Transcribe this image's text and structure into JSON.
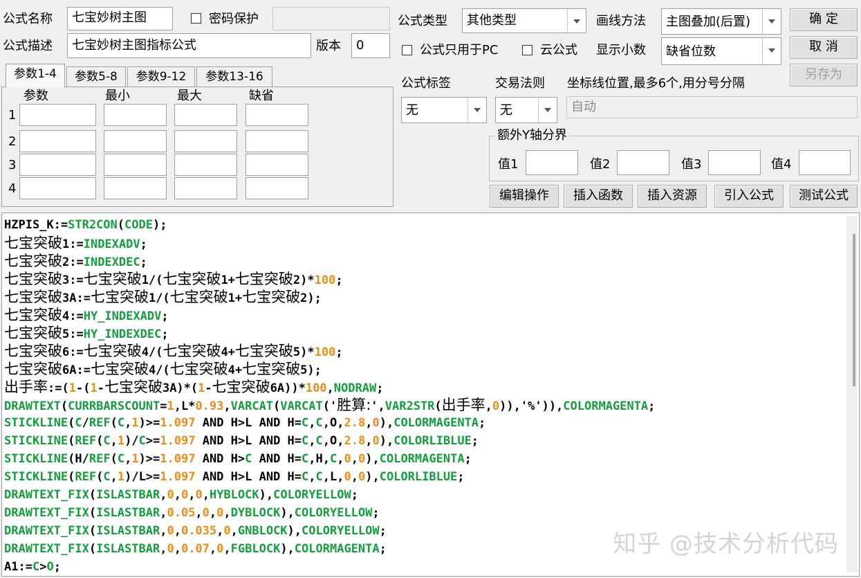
{
  "form": {
    "name_label": "公式名称",
    "name_value": "七宝妙树主图",
    "password_label": "密码保护",
    "password_value": "",
    "desc_label": "公式描述",
    "desc_value": "七宝妙树主图指标公式",
    "version_label": "版本",
    "version_value": "0",
    "type_label": "公式类型",
    "type_value": "其他类型",
    "draw_label": "画线方法",
    "draw_value": "主图叠加(后置)",
    "pc_only_label": "公式只用于PC",
    "cloud_label": "云公式",
    "decimal_label": "显示小数",
    "decimal_value": "缺省位数",
    "tag_label": "公式标签",
    "tag_value": "无",
    "trade_label": "交易法则",
    "trade_value": "无",
    "coord_label": "坐标线位置,最多6个,用分号分隔",
    "coord_value": "自动",
    "extra_y_label": "额外Y轴分界",
    "y_values": [
      {
        "label": "值1",
        "value": ""
      },
      {
        "label": "值2",
        "value": ""
      },
      {
        "label": "值3",
        "value": ""
      },
      {
        "label": "值4",
        "value": ""
      }
    ]
  },
  "buttons": {
    "ok": "确  定",
    "cancel": "取  消",
    "save_as": "另存为",
    "edit_ops": "编辑操作",
    "insert_func": "插入函数",
    "insert_res": "插入资源",
    "import_formula": "引入公式",
    "test_formula": "测试公式"
  },
  "params": {
    "tabs": [
      "参数1-4",
      "参数5-8",
      "参数9-12",
      "参数13-16"
    ],
    "headers": [
      "参数",
      "最小",
      "最大",
      "缺省"
    ],
    "rows": [
      "1",
      "2",
      "3",
      "4"
    ]
  },
  "code": {
    "lines": [
      [
        [
          "k",
          "HZPIS_K:="
        ],
        [
          "f",
          "STR2CON"
        ],
        [
          "k",
          "("
        ],
        [
          "f",
          "CODE"
        ],
        [
          "k",
          ");"
        ]
      ],
      [
        [
          "h",
          "七宝突破"
        ],
        [
          "k",
          "1:="
        ],
        [
          "f",
          "INDEXADV"
        ],
        [
          "k",
          ";"
        ]
      ],
      [
        [
          "h",
          "七宝突破"
        ],
        [
          "k",
          "2:="
        ],
        [
          "f",
          "INDEXDEC"
        ],
        [
          "k",
          ";"
        ]
      ],
      [
        [
          "h",
          "七宝突破"
        ],
        [
          "k",
          "3:="
        ],
        [
          "h",
          "七宝突破"
        ],
        [
          "k",
          "1/("
        ],
        [
          "h",
          "七宝突破"
        ],
        [
          "k",
          "1+"
        ],
        [
          "h",
          "七宝突破"
        ],
        [
          "k",
          "2)*"
        ],
        [
          "n",
          "100"
        ],
        [
          "k",
          ";"
        ]
      ],
      [
        [
          "h",
          "七宝突破"
        ],
        [
          "k",
          "3A:="
        ],
        [
          "h",
          "七宝突破"
        ],
        [
          "k",
          "1/("
        ],
        [
          "h",
          "七宝突破"
        ],
        [
          "k",
          "1+"
        ],
        [
          "h",
          "七宝突破"
        ],
        [
          "k",
          "2);"
        ]
      ],
      [
        [
          "h",
          "七宝突破"
        ],
        [
          "k",
          "4:="
        ],
        [
          "f",
          "HY_INDEXADV"
        ],
        [
          "k",
          ";"
        ]
      ],
      [
        [
          "h",
          "七宝突破"
        ],
        [
          "k",
          "5:="
        ],
        [
          "f",
          "HY_INDEXDEC"
        ],
        [
          "k",
          ";"
        ]
      ],
      [
        [
          "h",
          "七宝突破"
        ],
        [
          "k",
          "6:="
        ],
        [
          "h",
          "七宝突破"
        ],
        [
          "k",
          "4/("
        ],
        [
          "h",
          "七宝突破"
        ],
        [
          "k",
          "4+"
        ],
        [
          "h",
          "七宝突破"
        ],
        [
          "k",
          "5)*"
        ],
        [
          "n",
          "100"
        ],
        [
          "k",
          ";"
        ]
      ],
      [
        [
          "h",
          "七宝突破"
        ],
        [
          "k",
          "6A:="
        ],
        [
          "h",
          "七宝突破"
        ],
        [
          "k",
          "4/("
        ],
        [
          "h",
          "七宝突破"
        ],
        [
          "k",
          "4+"
        ],
        [
          "h",
          "七宝突破"
        ],
        [
          "k",
          "5);"
        ]
      ],
      [
        [
          "h",
          "出手率"
        ],
        [
          "k",
          ":=("
        ],
        [
          "n",
          "1"
        ],
        [
          "k",
          "-("
        ],
        [
          "n",
          "1"
        ],
        [
          "k",
          "-"
        ],
        [
          "h",
          "七宝突破"
        ],
        [
          "k",
          "3A)*("
        ],
        [
          "n",
          "1"
        ],
        [
          "k",
          "-"
        ],
        [
          "h",
          "七宝突破"
        ],
        [
          "k",
          "6A))*"
        ],
        [
          "n",
          "100"
        ],
        [
          "k",
          ","
        ],
        [
          "f",
          "NODRAW"
        ],
        [
          "k",
          ";"
        ]
      ],
      [
        [
          "f",
          "DRAWTEXT"
        ],
        [
          "k",
          "("
        ],
        [
          "f",
          "CURRBARSCOUNT"
        ],
        [
          "k",
          "="
        ],
        [
          "n",
          "1"
        ],
        [
          "k",
          ",L*"
        ],
        [
          "n",
          "0.93"
        ],
        [
          "k",
          ","
        ],
        [
          "f",
          "VARCAT"
        ],
        [
          "k",
          "("
        ],
        [
          "f",
          "VARCAT"
        ],
        [
          "k",
          "('"
        ],
        [
          "h",
          "胜算:"
        ],
        [
          "k",
          "',"
        ],
        [
          "f",
          "VAR2STR"
        ],
        [
          "k",
          "("
        ],
        [
          "h",
          "出手率"
        ],
        [
          "k",
          ","
        ],
        [
          "n",
          "0"
        ],
        [
          "k",
          ")),'%')),"
        ],
        [
          "f",
          "COLORMAGENTA"
        ],
        [
          "k",
          ";"
        ]
      ],
      [
        [
          "f",
          "STICKLINE"
        ],
        [
          "k",
          "("
        ],
        [
          "f",
          "C"
        ],
        [
          "k",
          "/"
        ],
        [
          "f",
          "REF"
        ],
        [
          "k",
          "("
        ],
        [
          "f",
          "C"
        ],
        [
          "k",
          ","
        ],
        [
          "n",
          "1"
        ],
        [
          "k",
          ")>="
        ],
        [
          "n",
          "1.097"
        ],
        [
          "k",
          " AND H>L AND H="
        ],
        [
          "f",
          "C"
        ],
        [
          "k",
          ","
        ],
        [
          "f",
          "C"
        ],
        [
          "k",
          ",O,"
        ],
        [
          "n",
          "2.8"
        ],
        [
          "k",
          ","
        ],
        [
          "n",
          "0"
        ],
        [
          "k",
          "),"
        ],
        [
          "f",
          "COLORMAGENTA"
        ],
        [
          "k",
          ";"
        ]
      ],
      [
        [
          "f",
          "STICKLINE"
        ],
        [
          "k",
          "("
        ],
        [
          "f",
          "REF"
        ],
        [
          "k",
          "("
        ],
        [
          "f",
          "C"
        ],
        [
          "k",
          ","
        ],
        [
          "n",
          "1"
        ],
        [
          "k",
          ")/"
        ],
        [
          "f",
          "C"
        ],
        [
          "k",
          ">="
        ],
        [
          "n",
          "1.097"
        ],
        [
          "k",
          " AND H>L AND H="
        ],
        [
          "f",
          "C"
        ],
        [
          "k",
          ","
        ],
        [
          "f",
          "C"
        ],
        [
          "k",
          ",O,"
        ],
        [
          "n",
          "2.8"
        ],
        [
          "k",
          ","
        ],
        [
          "n",
          "0"
        ],
        [
          "k",
          "),"
        ],
        [
          "f",
          "COLORLIBLUE"
        ],
        [
          "k",
          ";"
        ]
      ],
      [
        [
          "f",
          "STICKLINE"
        ],
        [
          "k",
          "(H/"
        ],
        [
          "f",
          "REF"
        ],
        [
          "k",
          "("
        ],
        [
          "f",
          "C"
        ],
        [
          "k",
          ","
        ],
        [
          "n",
          "1"
        ],
        [
          "k",
          ")>="
        ],
        [
          "n",
          "1.097"
        ],
        [
          "k",
          " AND H>"
        ],
        [
          "f",
          "C"
        ],
        [
          "k",
          " AND H="
        ],
        [
          "f",
          "C"
        ],
        [
          "k",
          ",H,"
        ],
        [
          "f",
          "C"
        ],
        [
          "k",
          ","
        ],
        [
          "n",
          "0"
        ],
        [
          "k",
          ","
        ],
        [
          "n",
          "0"
        ],
        [
          "k",
          "),"
        ],
        [
          "f",
          "COLORMAGENTA"
        ],
        [
          "k",
          ";"
        ]
      ],
      [
        [
          "f",
          "STICKLINE"
        ],
        [
          "k",
          "("
        ],
        [
          "f",
          "REF"
        ],
        [
          "k",
          "("
        ],
        [
          "f",
          "C"
        ],
        [
          "k",
          ","
        ],
        [
          "n",
          "1"
        ],
        [
          "k",
          ")/L>="
        ],
        [
          "n",
          "1.097"
        ],
        [
          "k",
          " AND H>L AND H="
        ],
        [
          "f",
          "C"
        ],
        [
          "k",
          ","
        ],
        [
          "f",
          "C"
        ],
        [
          "k",
          ",L,"
        ],
        [
          "n",
          "0"
        ],
        [
          "k",
          ","
        ],
        [
          "n",
          "0"
        ],
        [
          "k",
          "),"
        ],
        [
          "f",
          "COLORLIBLUE"
        ],
        [
          "k",
          ";"
        ]
      ],
      [
        [
          "f",
          "DRAWTEXT_FIX"
        ],
        [
          "k",
          "("
        ],
        [
          "f",
          "ISLASTBAR"
        ],
        [
          "k",
          ","
        ],
        [
          "n",
          "0"
        ],
        [
          "k",
          ","
        ],
        [
          "n",
          "0"
        ],
        [
          "k",
          ","
        ],
        [
          "n",
          "0"
        ],
        [
          "k",
          ","
        ],
        [
          "f",
          "HYBLOCK"
        ],
        [
          "k",
          "),"
        ],
        [
          "f",
          "COLORYELLOW"
        ],
        [
          "k",
          ";"
        ]
      ],
      [
        [
          "f",
          "DRAWTEXT_FIX"
        ],
        [
          "k",
          "("
        ],
        [
          "f",
          "ISLASTBAR"
        ],
        [
          "k",
          ","
        ],
        [
          "n",
          "0.05"
        ],
        [
          "k",
          ","
        ],
        [
          "n",
          "0"
        ],
        [
          "k",
          ","
        ],
        [
          "n",
          "0"
        ],
        [
          "k",
          ","
        ],
        [
          "f",
          "DYBLOCK"
        ],
        [
          "k",
          "),"
        ],
        [
          "f",
          "COLORYELLOW"
        ],
        [
          "k",
          ";"
        ]
      ],
      [
        [
          "f",
          "DRAWTEXT_FIX"
        ],
        [
          "k",
          "("
        ],
        [
          "f",
          "ISLASTBAR"
        ],
        [
          "k",
          ","
        ],
        [
          "n",
          "0"
        ],
        [
          "k",
          ","
        ],
        [
          "n",
          "0.035"
        ],
        [
          "k",
          ","
        ],
        [
          "n",
          "0"
        ],
        [
          "k",
          ","
        ],
        [
          "f",
          "GNBLOCK"
        ],
        [
          "k",
          "),"
        ],
        [
          "f",
          "COLORYELLOW"
        ],
        [
          "k",
          ";"
        ]
      ],
      [
        [
          "f",
          "DRAWTEXT_FIX"
        ],
        [
          "k",
          "("
        ],
        [
          "f",
          "ISLASTBAR"
        ],
        [
          "k",
          ","
        ],
        [
          "n",
          "0"
        ],
        [
          "k",
          ","
        ],
        [
          "n",
          "0.07"
        ],
        [
          "k",
          ","
        ],
        [
          "n",
          "0"
        ],
        [
          "k",
          ","
        ],
        [
          "f",
          "FGBLOCK"
        ],
        [
          "k",
          "),"
        ],
        [
          "f",
          "COLORMAGENTA"
        ],
        [
          "k",
          ";"
        ]
      ],
      [
        [
          "k",
          "A1:="
        ],
        [
          "f",
          "C"
        ],
        [
          "k",
          ">"
        ],
        [
          "f",
          "O"
        ],
        [
          "k",
          ";"
        ]
      ]
    ]
  },
  "watermark": "知乎 @技术分析代码"
}
